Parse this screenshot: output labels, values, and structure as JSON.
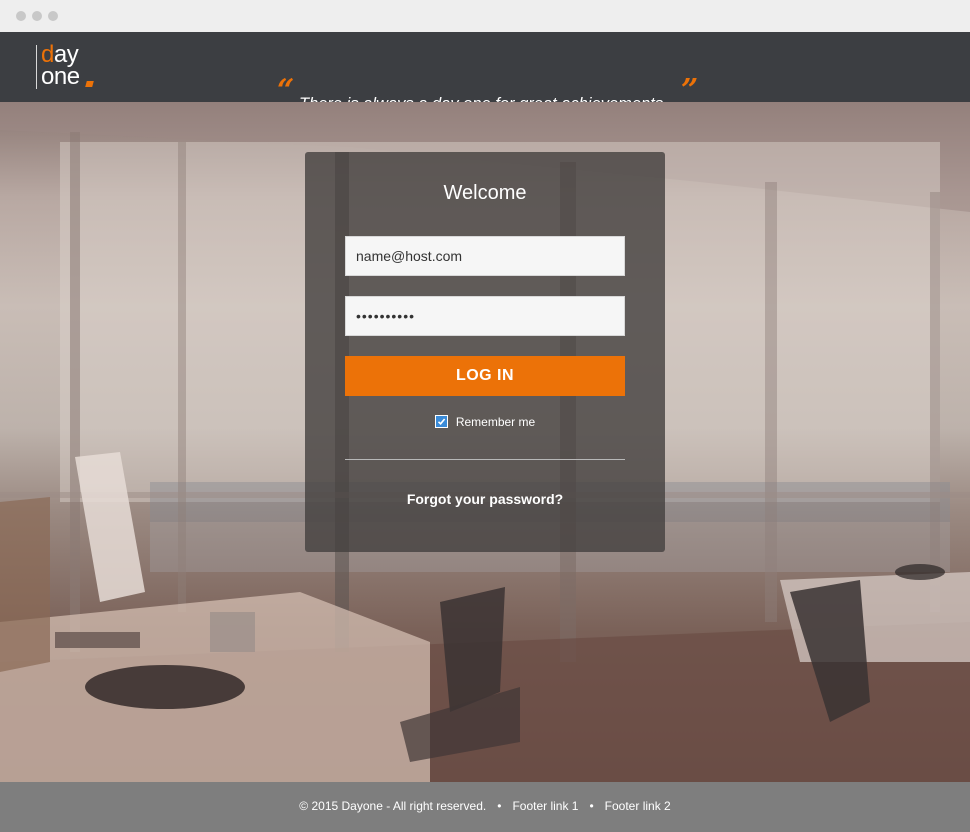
{
  "header": {
    "logo": {
      "line1_accent": "d",
      "line1_rest": "ay",
      "line2": "one"
    },
    "quote_open": "“",
    "quote_close": "”",
    "tagline": "There is always a day one for great achievements"
  },
  "login": {
    "title": "Welcome",
    "email_value": "name@host.com",
    "password_value": "••••••••••",
    "login_label": "LOG IN",
    "remember_label": "Remember me",
    "remember_checked": true,
    "forgot_label": "Forgot your password?"
  },
  "footer": {
    "copyright": "© 2015 Dayone - All right reserved.",
    "separator": "•",
    "link1": "Footer link 1",
    "link2": "Footer link 2"
  },
  "colors": {
    "accent": "#ec7208",
    "header_bg": "#3c3e42",
    "footer_bg": "#7e7e7e",
    "checkbox": "#3a8bd8"
  }
}
